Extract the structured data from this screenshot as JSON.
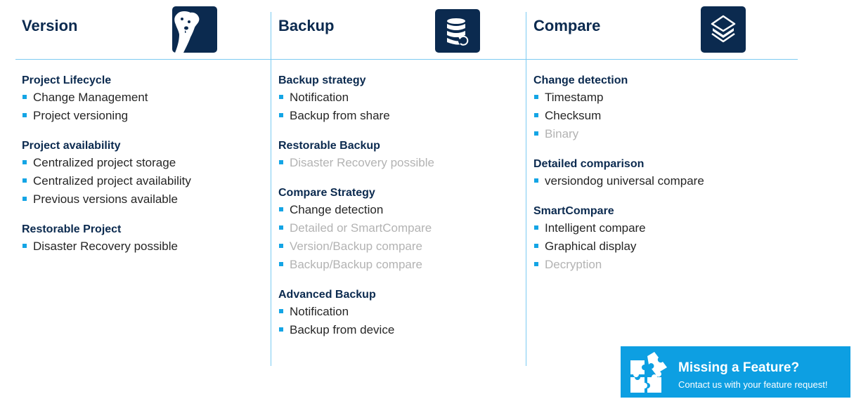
{
  "columns": [
    {
      "title": "Version",
      "icon": "dog-logo-icon",
      "sections": [
        {
          "title": "Project Lifecycle",
          "items": [
            {
              "label": "Change Management",
              "available": true
            },
            {
              "label": "Project versioning",
              "available": true
            }
          ]
        },
        {
          "title": "Project availability",
          "items": [
            {
              "label": "Centralized project storage",
              "available": true
            },
            {
              "label": "Centralized project availability",
              "available": true
            },
            {
              "label": "Previous versions available",
              "available": true
            }
          ]
        },
        {
          "title": "Restorable Project",
          "items": [
            {
              "label": "Disaster Recovery possible",
              "available": true
            }
          ]
        }
      ]
    },
    {
      "title": "Backup",
      "icon": "database-restore-icon",
      "sections": [
        {
          "title": "Backup strategy",
          "items": [
            {
              "label": "Notification",
              "available": true
            },
            {
              "label": "Backup from share",
              "available": true
            }
          ]
        },
        {
          "title": "Restorable Backup",
          "items": [
            {
              "label": "Disaster Recovery possible",
              "available": false
            }
          ]
        },
        {
          "title": "Compare Strategy",
          "items": [
            {
              "label": "Change detection",
              "available": true
            },
            {
              "label": "Detailed or SmartCompare",
              "available": false
            },
            {
              "label": "Version/Backup compare",
              "available": false
            },
            {
              "label": "Backup/Backup compare",
              "available": false
            }
          ]
        },
        {
          "title": "Advanced Backup",
          "items": [
            {
              "label": "Notification",
              "available": true
            },
            {
              "label": "Backup from device",
              "available": true
            }
          ]
        }
      ]
    },
    {
      "title": "Compare",
      "icon": "layers-icon",
      "sections": [
        {
          "title": "Change detection",
          "items": [
            {
              "label": "Timestamp",
              "available": true
            },
            {
              "label": "Checksum",
              "available": true
            },
            {
              "label": "Binary",
              "available": false
            }
          ]
        },
        {
          "title": "Detailed comparison",
          "items": [
            {
              "label": "versiondog universal compare",
              "available": true
            }
          ]
        },
        {
          "title": "SmartCompare",
          "items": [
            {
              "label": "Intelligent compare",
              "available": true
            },
            {
              "label": "Graphical display",
              "available": true
            },
            {
              "label": "Decryption",
              "available": false
            }
          ]
        }
      ]
    }
  ],
  "banner": {
    "title": "Missing a Feature?",
    "subtitle": "Contact us with your feature request!",
    "icon": "puzzle-icon"
  },
  "colors": {
    "heading": "#0b2a4f",
    "accent": "#14a5e5",
    "divider": "#7ccbf2",
    "unavailable_text": "#b3b3b3",
    "banner_bg": "#0d9fe2"
  }
}
